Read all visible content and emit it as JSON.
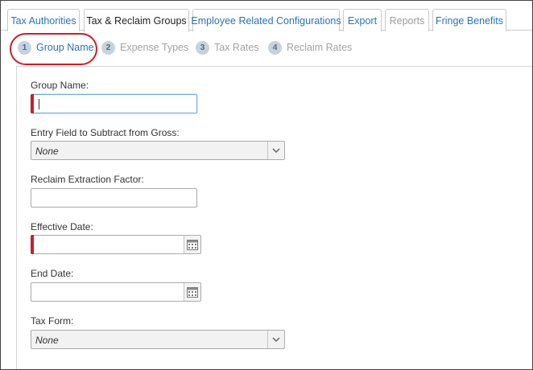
{
  "tabs": [
    {
      "label": "Tax Authorities"
    },
    {
      "label": "Tax & Reclaim Groups"
    },
    {
      "label": "Employee Related Configurations"
    },
    {
      "label": "Export"
    },
    {
      "label": "Reports"
    },
    {
      "label": "Fringe Benefits"
    }
  ],
  "steps": [
    {
      "num": "1",
      "label": "Group Name"
    },
    {
      "num": "2",
      "label": "Expense Types"
    },
    {
      "num": "3",
      "label": "Tax Rates"
    },
    {
      "num": "4",
      "label": "Reclaim Rates"
    }
  ],
  "form": {
    "group_name": {
      "label": "Group Name:",
      "value": ""
    },
    "entry_field": {
      "label": "Entry Field to Subtract from Gross:",
      "value": "None"
    },
    "reclaim_factor": {
      "label": "Reclaim Extraction Factor:",
      "value": ""
    },
    "effective_date": {
      "label": "Effective Date:",
      "value": ""
    },
    "end_date": {
      "label": "End Date:",
      "value": ""
    },
    "tax_form": {
      "label": "Tax Form:",
      "value": "None"
    }
  },
  "colors": {
    "link": "#2a73b8",
    "required": "#c8202a",
    "highlight_ring": "#c8202a"
  },
  "icons": {
    "calendar": "calendar-icon",
    "dropdown": "chevron-down-icon"
  }
}
